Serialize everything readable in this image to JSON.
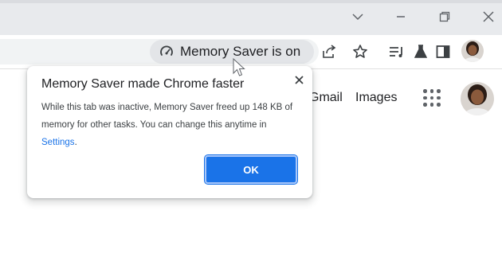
{
  "window": {
    "controls": [
      "chevron-down",
      "minimize",
      "restore",
      "close"
    ]
  },
  "toolbar": {
    "memory_chip_label": "Memory Saver is on",
    "icons": [
      "speedometer-icon",
      "share-icon",
      "star-icon",
      "tab-search-icon",
      "labs-flask-icon",
      "side-panel-icon",
      "profile-avatar"
    ]
  },
  "page": {
    "gmail_label": "Gmail",
    "images_label": "Images"
  },
  "bubble": {
    "title": "Memory Saver made Chrome faster",
    "body_text": "While this tab was inactive, Memory Saver freed up 148 KB of memory for other tasks. You can change this anytime in ",
    "settings_link": "Settings",
    "body_end": ".",
    "ok_label": "OK"
  },
  "colors": {
    "accent": "#1a73e8",
    "titlebar": "#e8eaed",
    "chip": "#e3e5e8"
  }
}
